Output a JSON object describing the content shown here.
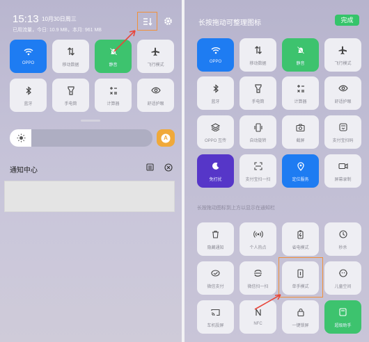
{
  "left": {
    "status": {
      "time": "15:13",
      "date": "10月30日周三",
      "usage": "已用流量，今日: 10.9 MB，本月: 961 MB"
    },
    "header_icons": {
      "edit": "sort-edit-icon",
      "settings": "gear-icon"
    },
    "tiles": [
      {
        "label": "OPPO",
        "icon": "wifi-icon",
        "state": "active"
      },
      {
        "label": "移动数据",
        "icon": "data-arrows-icon",
        "state": "off"
      },
      {
        "label": "静音",
        "icon": "bell-off-icon",
        "state": "on"
      },
      {
        "label": "飞行模式",
        "icon": "airplane-icon",
        "state": "off"
      },
      {
        "label": "蓝牙",
        "icon": "bluetooth-icon",
        "state": "off"
      },
      {
        "label": "手电筒",
        "icon": "flashlight-icon",
        "state": "off"
      },
      {
        "label": "计算器",
        "icon": "calculator-icon",
        "state": "off"
      },
      {
        "label": "舒适护眼",
        "icon": "eye-icon",
        "state": "off"
      }
    ],
    "brightness": {
      "level": 0.15,
      "auto_label": "A"
    },
    "notifications": {
      "title": "通知中心"
    }
  },
  "right": {
    "title": "长按拖动可整理图标",
    "done_label": "完成",
    "active_tiles": [
      {
        "label": "OPPO",
        "icon": "wifi-icon",
        "state": "active"
      },
      {
        "label": "移动数据",
        "icon": "data-arrows-icon",
        "state": "off"
      },
      {
        "label": "静音",
        "icon": "bell-off-icon",
        "state": "on"
      },
      {
        "label": "飞行模式",
        "icon": "airplane-icon",
        "state": "off"
      },
      {
        "label": "蓝牙",
        "icon": "bluetooth-icon",
        "state": "off"
      },
      {
        "label": "手电筒",
        "icon": "flashlight-icon",
        "state": "off"
      },
      {
        "label": "计算器",
        "icon": "calculator-icon",
        "state": "off"
      },
      {
        "label": "舒适护眼",
        "icon": "eye-icon",
        "state": "off"
      },
      {
        "label": "OPPO 互传",
        "icon": "share-layers-icon",
        "state": "off"
      },
      {
        "label": "自动旋转",
        "icon": "rotate-icon",
        "state": "off"
      },
      {
        "label": "截屏",
        "icon": "camera-icon",
        "state": "off"
      },
      {
        "label": "支付宝扫码",
        "icon": "scan-pay-icon",
        "state": "off"
      },
      {
        "label": "免打扰",
        "icon": "moon-icon",
        "state": "dnd"
      },
      {
        "label": "支付宝扫一扫",
        "icon": "scan-icon",
        "state": "off"
      },
      {
        "label": "定位服务",
        "icon": "location-icon",
        "state": "active"
      },
      {
        "label": "屏幕录制",
        "icon": "video-icon",
        "state": "off"
      }
    ],
    "section_label": "长按拖动图标到上方以显示在通知栏",
    "extra_tiles": [
      {
        "label": "隐藏通知",
        "icon": "trash-icon",
        "state": "off"
      },
      {
        "label": "个人热点",
        "icon": "hotspot-icon",
        "state": "off"
      },
      {
        "label": "省电模式",
        "icon": "battery-icon",
        "state": "off"
      },
      {
        "label": "秒杀",
        "icon": "clock-icon",
        "state": "off"
      },
      {
        "label": "微信支付",
        "icon": "wechat-pay-icon",
        "state": "off"
      },
      {
        "label": "微信扫一扫",
        "icon": "wechat-scan-icon",
        "state": "off"
      },
      {
        "label": "单手模式",
        "icon": "phone-icon",
        "state": "off"
      },
      {
        "label": "儿童空间",
        "icon": "kid-face-icon",
        "state": "off"
      },
      {
        "label": "车机投屏",
        "icon": "cast-icon",
        "state": "off"
      },
      {
        "label": "NFC",
        "icon": "nfc-icon",
        "state": "off"
      },
      {
        "label": "一键锁屏",
        "icon": "lock-icon",
        "state": "off"
      },
      {
        "label": "超级助手",
        "icon": "app-icon",
        "state": "active-green"
      }
    ]
  },
  "colors": {
    "accent_orange": "#f0913a",
    "blue_active": "#1e7cf2",
    "green_active": "#3dc36e",
    "purple_dnd": "#5636c8"
  }
}
